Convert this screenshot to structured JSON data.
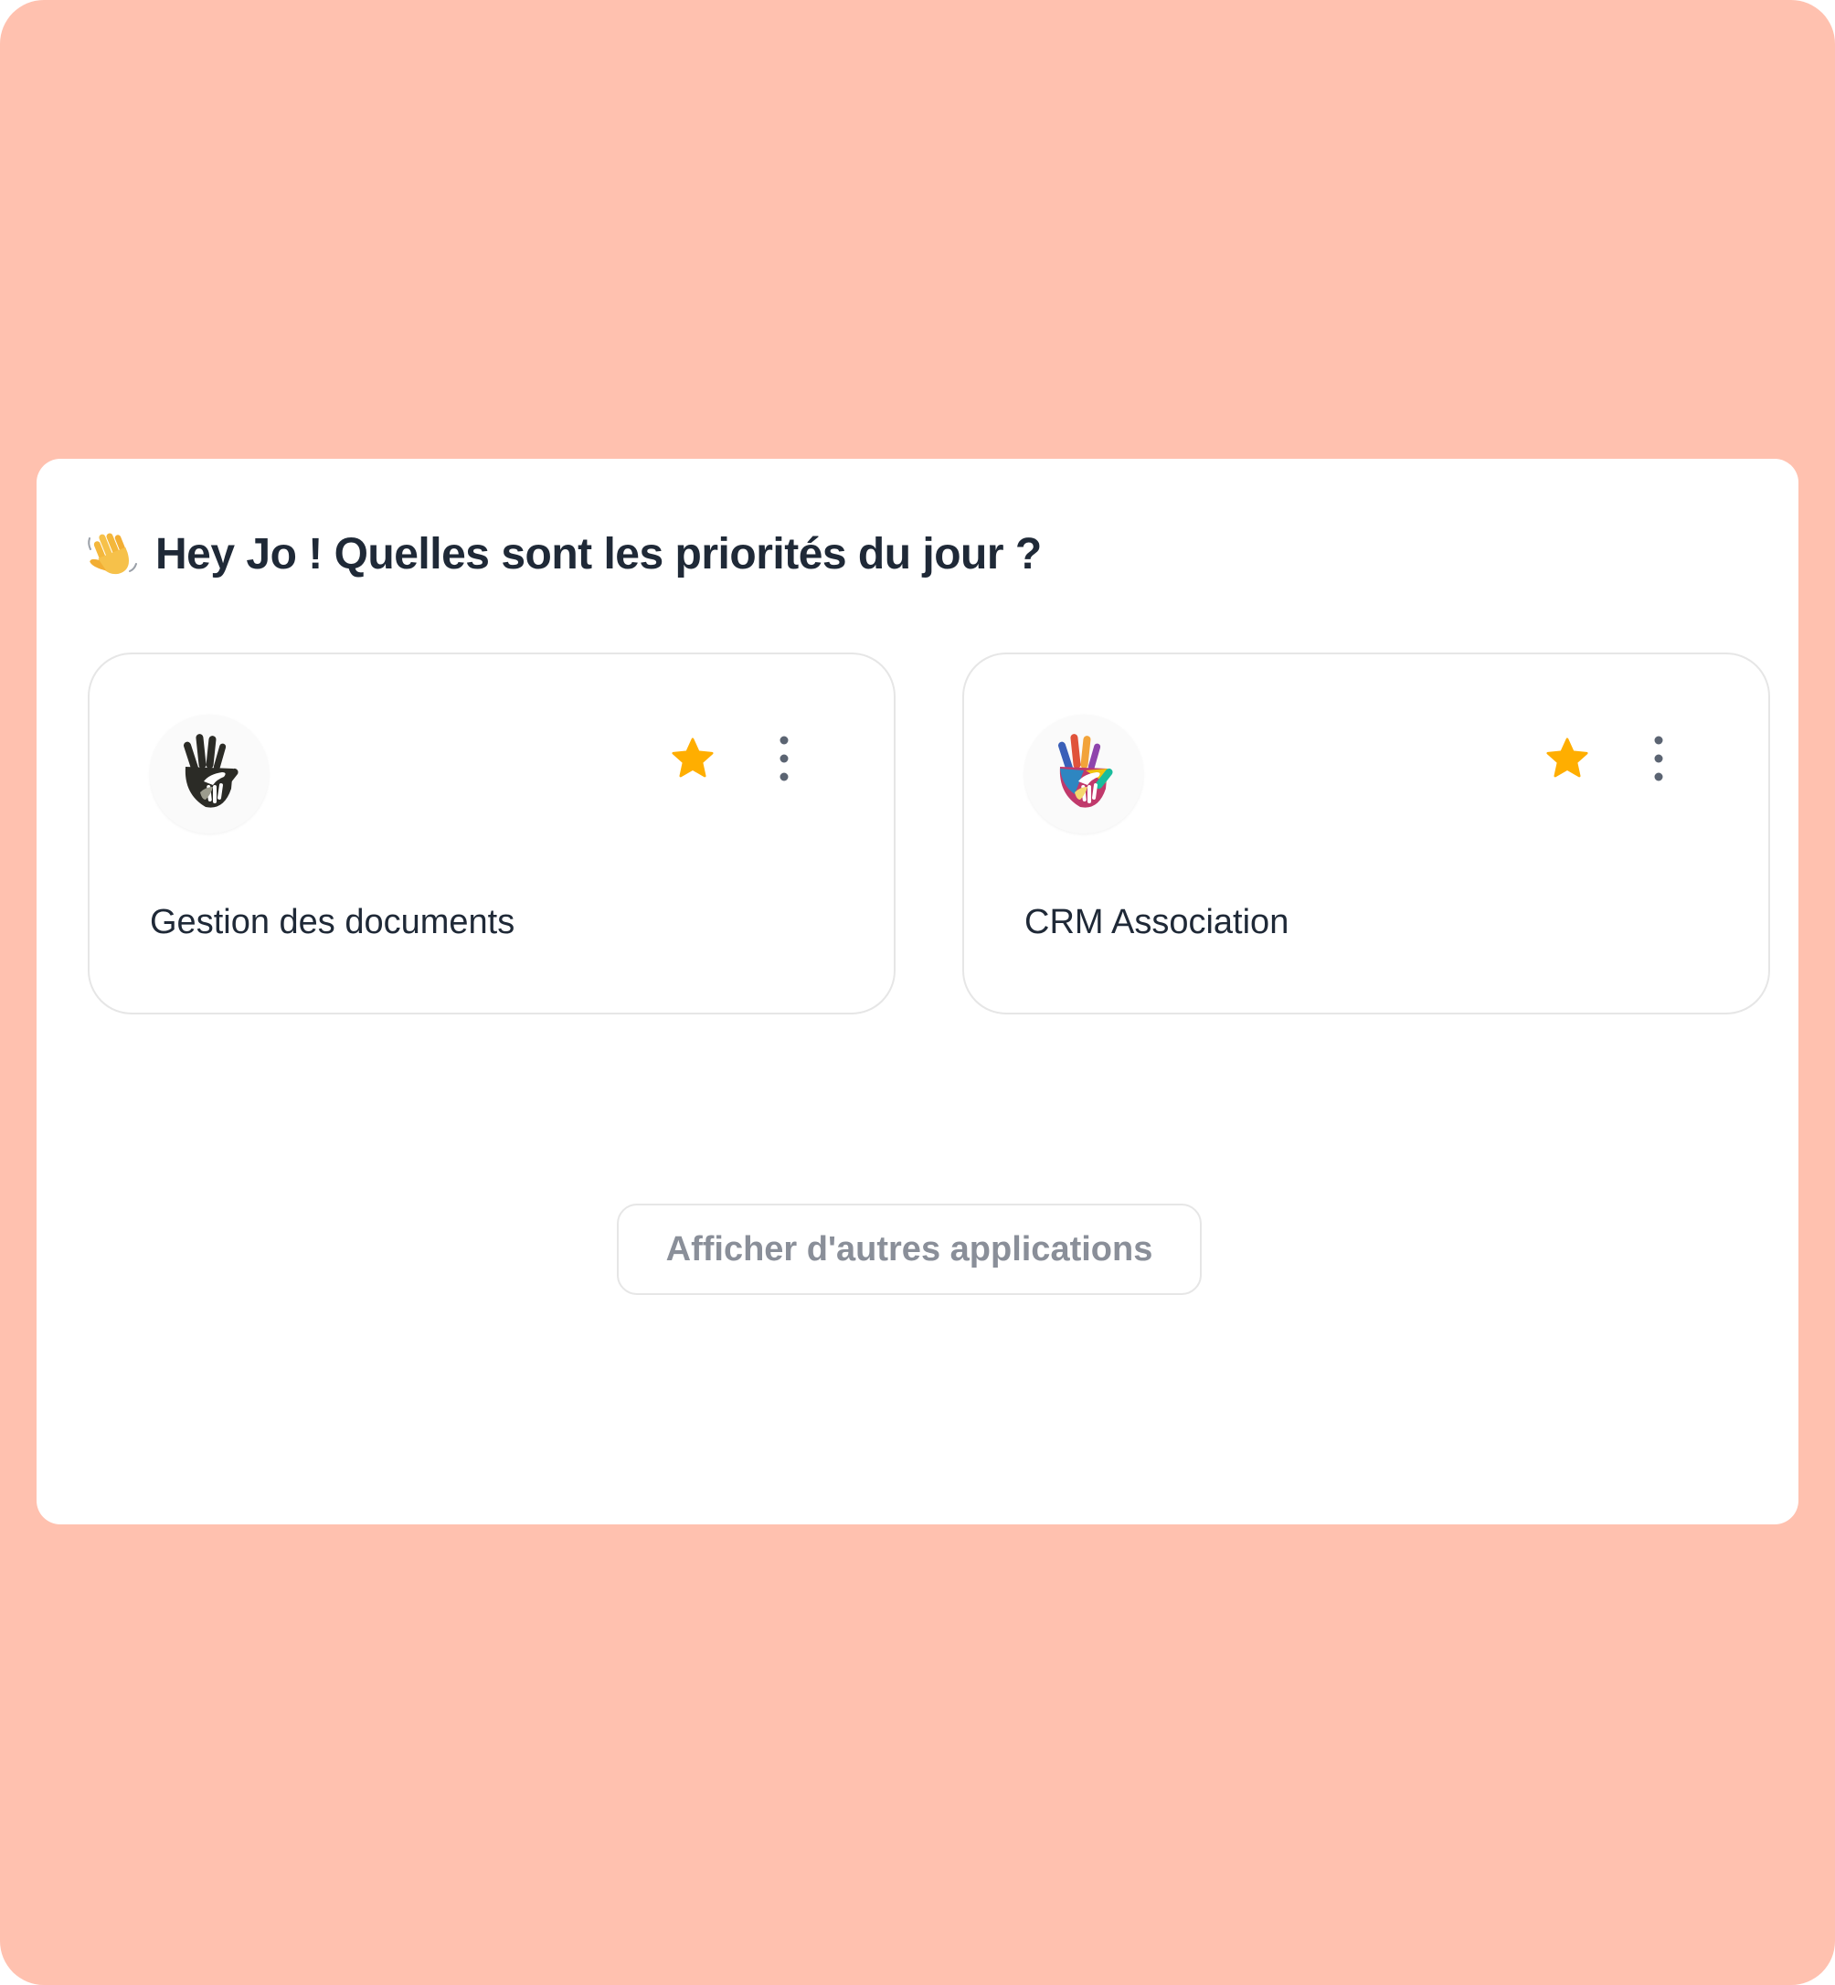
{
  "greeting": {
    "icon": "waving-hand-icon",
    "text": "Hey Jo ! Quelles sont les priorités du jour ?"
  },
  "apps": [
    {
      "name": "Gestion des documents",
      "logo": "dark-hands-logo",
      "favorite": true,
      "menu_icon": "more-vertical-icon"
    },
    {
      "name": "CRM Association",
      "logo": "colorful-hands-logo",
      "favorite": true,
      "menu_icon": "more-vertical-icon"
    }
  ],
  "more_apps_label": "Afficher d'autres applications",
  "colors": {
    "background": "#FFC1AF",
    "panel": "#FFFFFF",
    "star": "#FFAE00",
    "title_text": "#1F2937",
    "muted_text": "#8A8F99",
    "border": "#E6E6E6",
    "menu_dots": "#5B6472"
  }
}
